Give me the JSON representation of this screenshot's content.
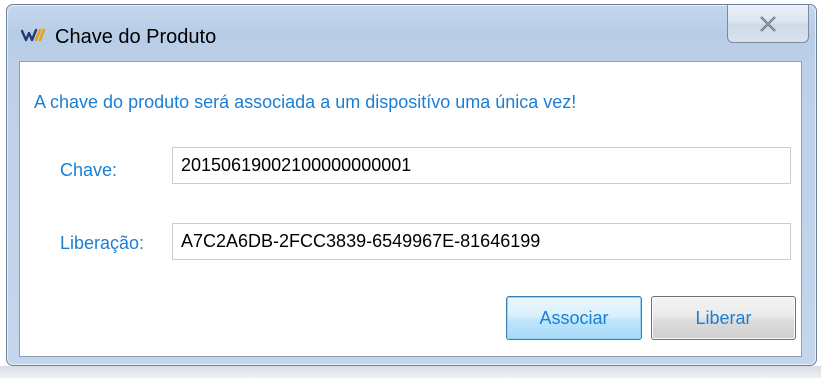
{
  "window": {
    "title": "Chave do Produto",
    "icon": "app-logo-icon",
    "close_icon": "close-icon"
  },
  "message": "A chave do produto será associada a um dispositívo uma única vez!",
  "fields": {
    "chave": {
      "label": "Chave:",
      "value": "20150619002100000000001"
    },
    "liberacao": {
      "label": "Liberação:",
      "value": "A7C2A6DB-2FCC3839-6549967E-81646199"
    }
  },
  "buttons": {
    "associar": "Associar",
    "liberar": "Liberar"
  },
  "colors": {
    "accent_text": "#1a7fd4",
    "titlebar": "#b7cce6"
  }
}
